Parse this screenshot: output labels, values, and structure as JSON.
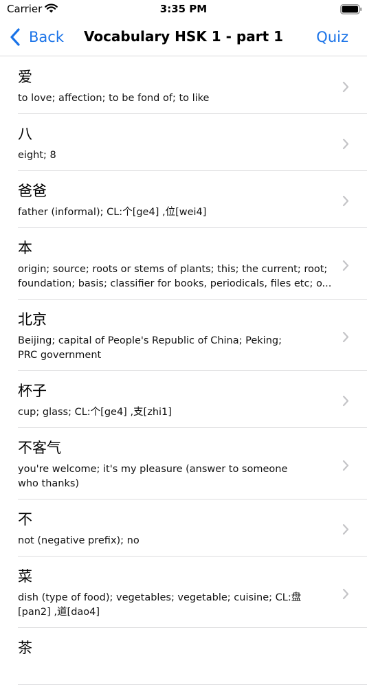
{
  "status_bar": {
    "carrier": "Carrier",
    "time": "3:35 PM"
  },
  "nav": {
    "back_label": "Back",
    "title": "Vocabulary HSK 1 - part 1",
    "quiz_label": "Quiz"
  },
  "entries": [
    {
      "word": "爱",
      "lines": [
        "to love; affection; to be fond of; to like"
      ]
    },
    {
      "word": "八",
      "lines": [
        "eight; 8"
      ]
    },
    {
      "word": "爸爸",
      "lines": [
        "father (informal); CL:个[ge4] ,位[wei4]"
      ]
    },
    {
      "word": "本",
      "lines": [
        "origin; source; roots or stems of plants; this; the current; root;",
        "foundation; basis; classifier for books, periodicals, files etc; o..."
      ]
    },
    {
      "word": "北京",
      "lines": [
        "Beijing; capital of People's Republic of China; Peking;",
        "PRC government"
      ]
    },
    {
      "word": "杯子",
      "lines": [
        "cup; glass; CL:个[ge4] ,支[zhi1]"
      ]
    },
    {
      "word": "不客气",
      "lines": [
        "you're welcome; it's my pleasure (answer to someone",
        "who thanks)"
      ]
    },
    {
      "word": "不",
      "lines": [
        "not (negative prefix); no"
      ]
    },
    {
      "word": "菜",
      "lines": [
        "dish (type of food); vegetables; vegetable; cuisine; CL:盘",
        "[pan2] ,道[dao4]"
      ]
    },
    {
      "word": "茶",
      "lines": []
    }
  ],
  "colors": {
    "accent": "#1a73e8",
    "separator": "#dcdcde",
    "chevron": "#c4c4c7"
  },
  "icons": {
    "row_disclosure": "chevron-right-icon",
    "back": "chevron-left-icon"
  }
}
